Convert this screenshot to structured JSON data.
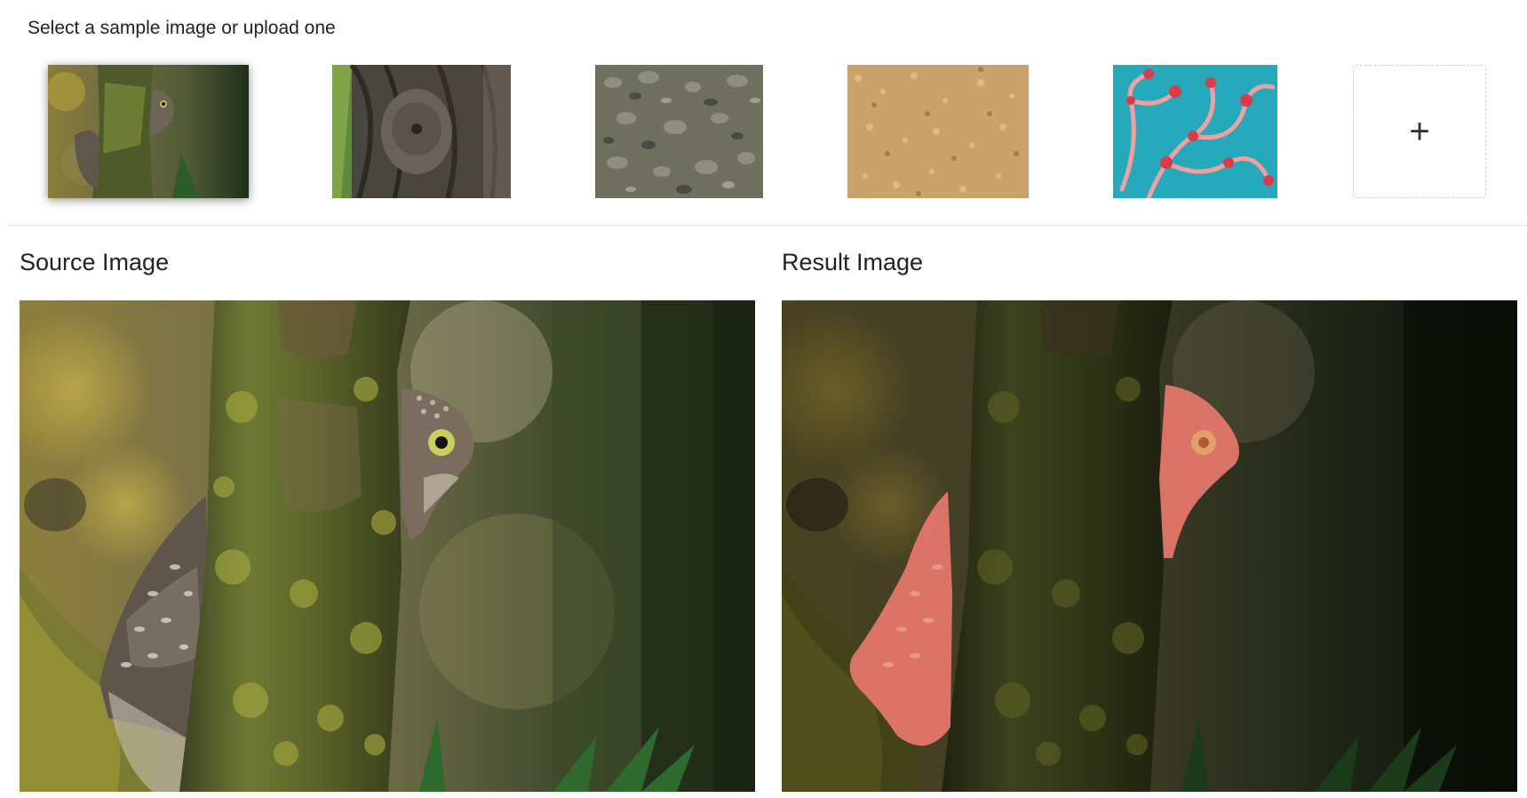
{
  "header": {
    "prompt": "Select a sample image or upload one"
  },
  "samples": [
    {
      "name": "owl behind tree",
      "selected": true
    },
    {
      "name": "screech owl on bark",
      "selected": false
    },
    {
      "name": "bird on gravel",
      "selected": false
    },
    {
      "name": "sand",
      "selected": false
    },
    {
      "name": "pygmy seahorse on coral",
      "selected": false
    }
  ],
  "upload": {
    "icon": "plus-icon",
    "glyph": "+"
  },
  "source": {
    "title": "Source Image"
  },
  "result": {
    "title": "Result Image",
    "mask_color": "#f07c70"
  }
}
